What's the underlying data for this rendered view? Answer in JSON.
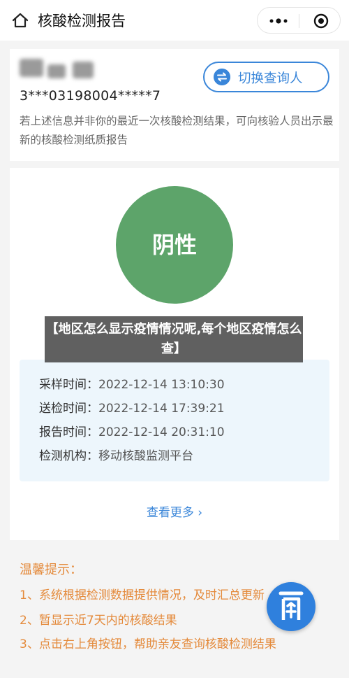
{
  "header": {
    "title": "核酸检测报告",
    "home_icon": "home-icon",
    "more_icon": "more-dots-icon",
    "close_icon": "target-close-icon"
  },
  "user": {
    "id_number": "3***03198004*****7",
    "note": "若上述信息并非你的最近一次核酸检测结果，可向核验人员出示最新的核酸检测纸质报告",
    "switch_label": "切换查询人",
    "switch_icon": "switch-user-icon"
  },
  "result": {
    "status": "阴性",
    "status_color": "#5da46a",
    "info": [
      {
        "label": "采样时间：",
        "value": "2022-12-14 13:10:30"
      },
      {
        "label": "送检时间：",
        "value": "2022-12-14 17:39:21"
      },
      {
        "label": "报告时间：",
        "value": "2022-12-14 20:31:10"
      },
      {
        "label": "检测机构：",
        "value": "移动核酸监测平台"
      }
    ],
    "more_link": "查看更多 ›"
  },
  "overlay_text": "【地区怎么显示疫情情况呢,每个地区疫情怎么查】",
  "tips": {
    "title": "温馨提示：",
    "items": [
      "1、系统根据检测数据提供情况，及时汇总更新",
      "2、暂显示近7天内的核酸结果",
      "3、点击右上角按钮，帮助亲友查询核酸检测结果"
    ],
    "color": "#e48a3b"
  },
  "fab_icon": "app-logo-icon",
  "accent": "#3a86d9"
}
